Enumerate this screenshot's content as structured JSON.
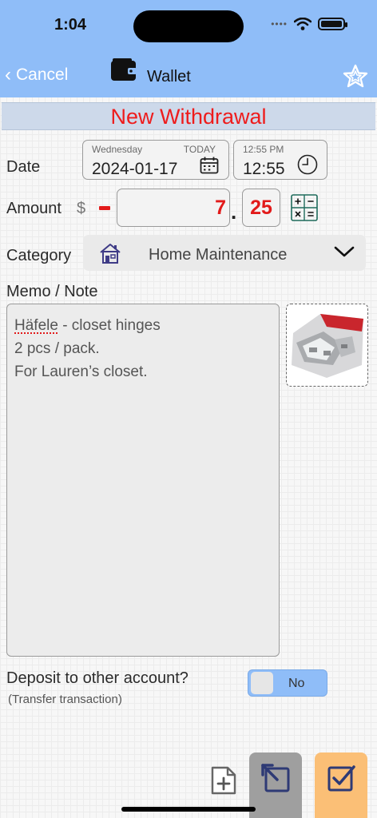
{
  "status_bar": {
    "time": "1:04"
  },
  "nav": {
    "cancel_label": "Cancel",
    "title": "Wallet",
    "wallet_icon": "wallet-icon",
    "favorite_icon": "star-icon"
  },
  "form": {
    "heading": "New Withdrawal",
    "date": {
      "label": "Date",
      "weekday": "Wednesday",
      "today_tag": "TODAY",
      "value": "2024-01-17"
    },
    "time": {
      "hint": "12:55 PM",
      "value": "12:55"
    },
    "amount": {
      "label": "Amount",
      "currency": "$",
      "dollars": "7",
      "separator": ".",
      "cents": "25"
    },
    "category": {
      "label": "Category",
      "value": "Home Maintenance"
    },
    "memo": {
      "label": "Memo / Note",
      "first_line": "Häfele",
      "text": " - closet hinges\n2 pcs / pack.\nFor Lauren’s closet."
    },
    "deposit": {
      "question": "Deposit to other account?",
      "subtext": "(Transfer transaction)",
      "toggle_value": "No"
    }
  },
  "colors": {
    "header": "#8fbdf8",
    "withdrawal_red": "#e21a1a",
    "save_button": "#fbbf76",
    "undo_button": "#9f9f9f",
    "icon_navy": "#2e3a75"
  }
}
